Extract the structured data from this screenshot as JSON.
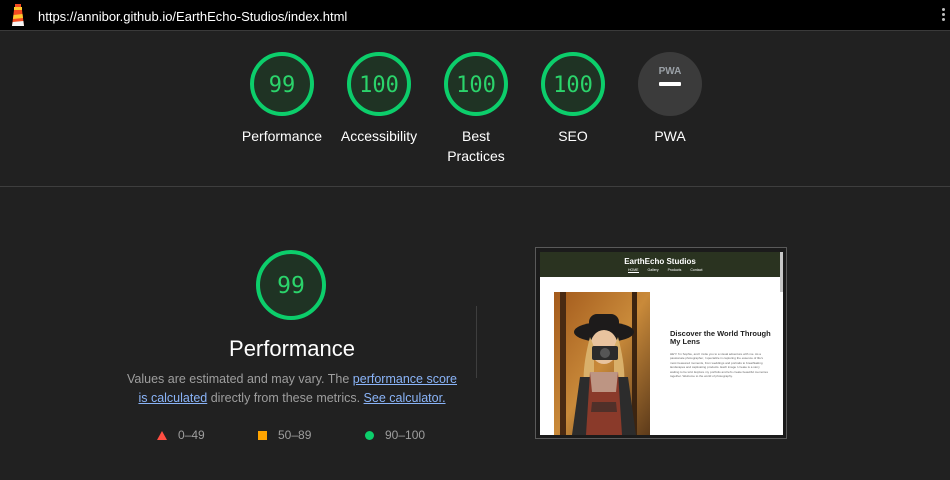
{
  "topbar": {
    "url": "https://annibor.github.io/EarthEcho-Studios/index.html",
    "logo_icon": "lighthouse-icon",
    "menu_icon": "more-vert-icon"
  },
  "categories": [
    {
      "score": "99",
      "label": "Performance",
      "status": "pass"
    },
    {
      "score": "100",
      "label": "Accessibility",
      "status": "pass"
    },
    {
      "score": "100",
      "label_line1": "Best",
      "label_line2": "Practices",
      "status": "pass"
    },
    {
      "score": "100",
      "label": "SEO",
      "status": "pass"
    },
    {
      "badge": "PWA",
      "label": "PWA",
      "status": "na"
    }
  ],
  "performance": {
    "score": "99",
    "title": "Performance",
    "desc_prefix": "Values are estimated and may vary. The ",
    "link_score": "performance score is calculated",
    "desc_mid": " directly from these metrics. ",
    "link_calc": "See calculator.",
    "legend": [
      {
        "icon": "triangle-icon",
        "range": "0–49",
        "color": "#ff4e42"
      },
      {
        "icon": "square-icon",
        "range": "50–89",
        "color": "#ffa400"
      },
      {
        "icon": "circle-icon",
        "range": "90–100",
        "color": "#0cce6b"
      }
    ]
  },
  "thumbnail": {
    "site_title": "EarthEcho Studios",
    "nav": [
      "HOME",
      "Gallery",
      "Products",
      "Contact"
    ],
    "hero_title": "Discover the World Through My Lens",
    "hero_text": "HEY! I'm Sophie, and I invite you to a visual adventure with me. As a passionate photographer, I specialize in capturing the essence of life's most treasured moments, from weddings and portraits to breathtaking landscapes and captivating products. Each image I create is a story waiting to be told. Explore my portfolio and let's create beautiful memories together. Welcome to the world of photography."
  },
  "colors": {
    "pass": "#0cce6b",
    "background": "#212121",
    "link": "#8ab4f8"
  }
}
